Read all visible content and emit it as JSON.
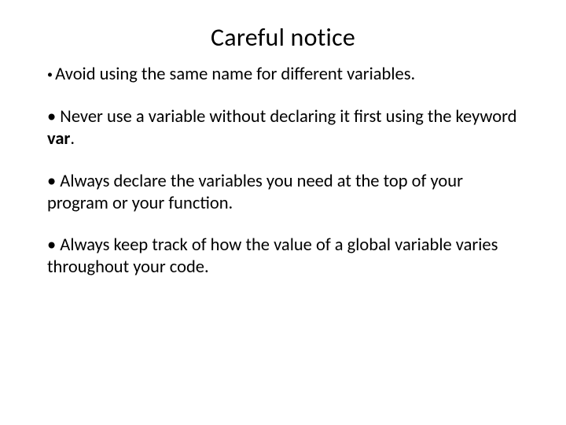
{
  "title": "Careful notice",
  "bullets": {
    "b1": "Avoid using the same name for different variables.",
    "b2a": "Never use a variable without declaring it first using the keyword ",
    "b2b": "var",
    "b2c": ".",
    "b3": "Always declare the variables you need at the top of your program or your function.",
    "b4": "Always keep track of how the value of a global variable varies throughout your code."
  }
}
